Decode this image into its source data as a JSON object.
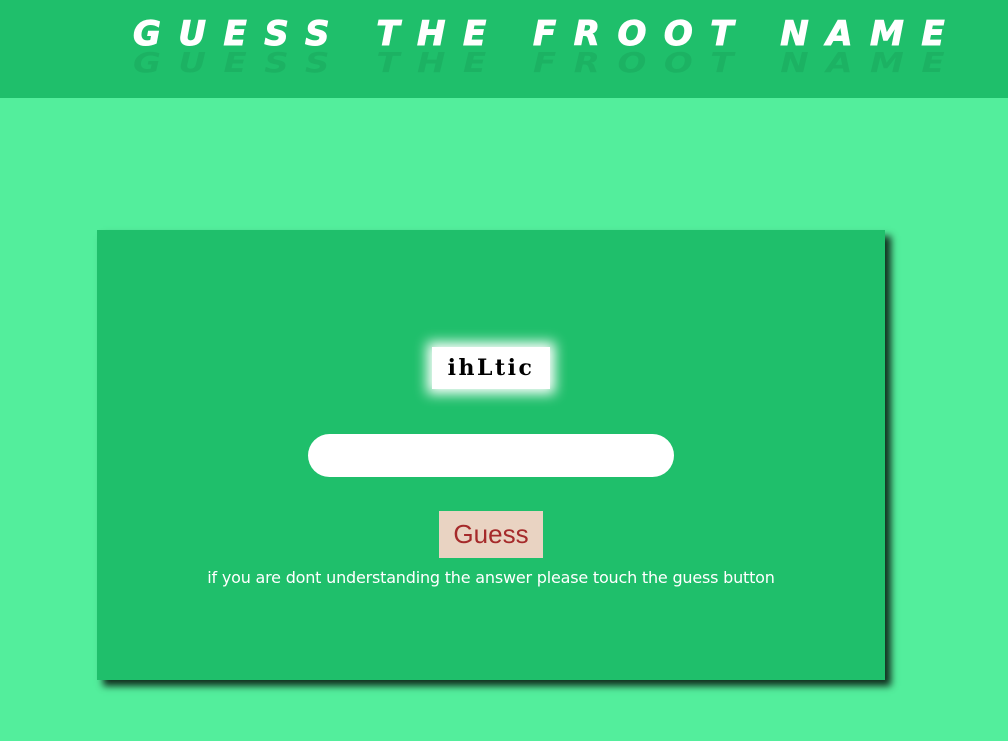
{
  "header": {
    "title": "GUESS THE FROOT NAME"
  },
  "game": {
    "scrambled_word": "ihLtic",
    "answer_input_value": "",
    "guess_button_label": "Guess",
    "hint_text": "if you are dont understanding the answer please touch the guess button"
  },
  "colors": {
    "page_background": "#53ee9c",
    "header_background": "#1fbf6b",
    "card_background": "#1fbf6b",
    "button_background": "#e9d3c2",
    "button_text": "#a52a2a"
  }
}
